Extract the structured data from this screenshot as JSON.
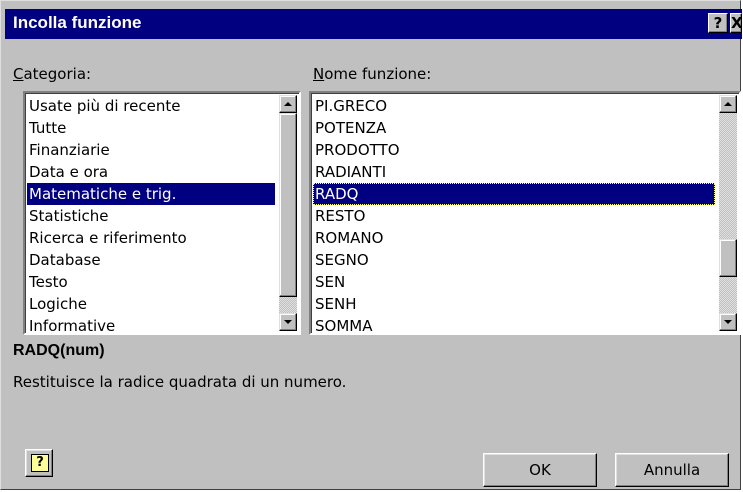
{
  "window": {
    "title": "Incolla funzione",
    "help_glyph": "?",
    "close_glyph": "X"
  },
  "categories": {
    "label_access": "C",
    "label_rest": "ategoria:",
    "items": [
      "Usate più di recente",
      "Tutte",
      "Finanziarie",
      "Data e ora",
      "Matematiche e trig.",
      "Statistiche",
      "Ricerca e riferimento",
      "Database",
      "Testo",
      "Logiche",
      "Informative"
    ],
    "selected": "Matematiche e trig."
  },
  "functions": {
    "label_access": "N",
    "label_rest": "ome funzione:",
    "items": [
      "PI.GRECO",
      "POTENZA",
      "PRODOTTO",
      "RADIANTI",
      "RADQ",
      "RESTO",
      "ROMANO",
      "SEGNO",
      "SEN",
      "SENH",
      "SOMMA"
    ],
    "selected": "RADQ"
  },
  "description": {
    "syntax": "RADQ(num)",
    "text": "Restituisce la radice quadrata di un numero."
  },
  "buttons": {
    "ok": "OK",
    "cancel": "Annulla",
    "assistant_glyph": "?"
  },
  "colors": {
    "titlebar": "#000080",
    "selection": "#000080",
    "face": "#c0c0c0"
  }
}
